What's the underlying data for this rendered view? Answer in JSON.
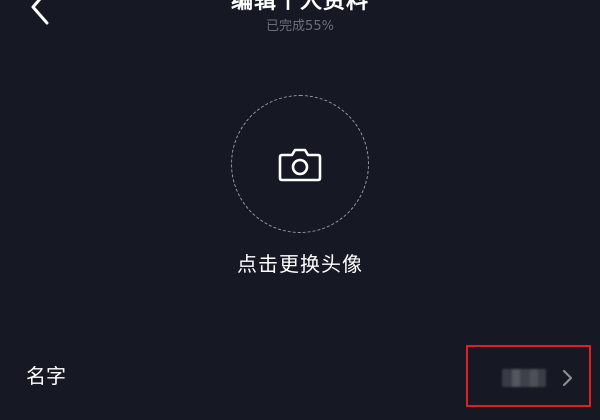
{
  "header": {
    "title": "编辑个人资料",
    "subtitle": "已完成55%",
    "back_icon": "chevron-left-icon"
  },
  "avatar": {
    "icon": "camera-icon",
    "label": "点击更换头像"
  },
  "fields": {
    "name": {
      "label": "名字",
      "value": "",
      "icon": "chevron-right-icon",
      "highlight_color": "#e02020"
    }
  },
  "colors": {
    "background": "#161823",
    "text_primary": "#ffffff",
    "text_secondary": "#6c6e79"
  }
}
